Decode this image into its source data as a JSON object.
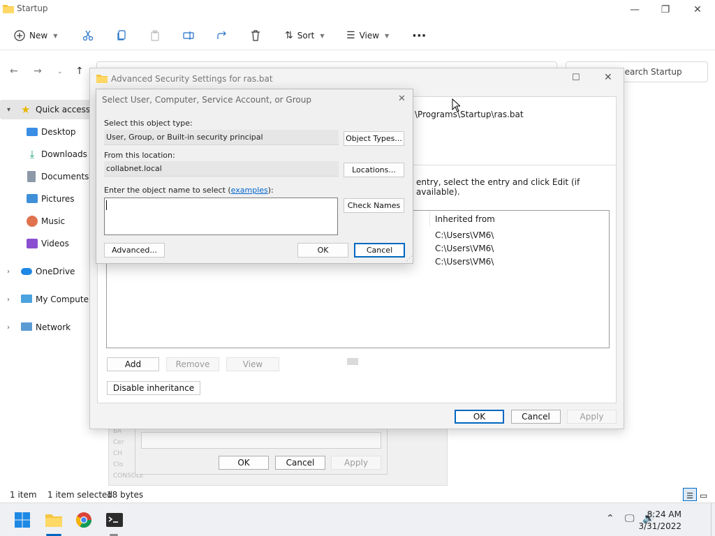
{
  "explorer": {
    "title": "Startup",
    "toolbar": {
      "new_label": "New",
      "sort_label": "Sort",
      "view_label": "View",
      "more_label": "···"
    },
    "search_placeholder": "Search Startup",
    "sidebar": {
      "quick_access": "Quick access",
      "desktop": "Desktop",
      "downloads": "Downloads",
      "documents": "Documents",
      "pictures": "Pictures",
      "music": "Music",
      "videos": "Videos",
      "onedrive": "OneDrive",
      "my_computer": "My Computer",
      "network": "Network"
    },
    "status": {
      "items": "1 item",
      "selected": "1 item selected",
      "size": "18 bytes"
    }
  },
  "advanced": {
    "title": "Advanced Security Settings for ras.bat",
    "path_text": "\\Programs\\Startup\\ras.bat",
    "instruction": "entry, select the entry and click Edit (if available).",
    "column_inherited": "Inherited from",
    "rows": [
      "C:\\Users\\VM6\\",
      "C:\\Users\\VM6\\",
      "C:\\Users\\VM6\\"
    ],
    "add_label": "Add",
    "remove_label": "Remove",
    "view_label": "View",
    "disable_inheritance_label": "Disable inheritance",
    "ok_label": "OK",
    "cancel_label": "Cancel",
    "apply_label": "Apply"
  },
  "background_dialog": {
    "ok_label": "OK",
    "cancel_label": "Cancel",
    "apply_label": "Apply",
    "ghost_rows": [
      "BA",
      "Cer",
      "CH",
      "Clo",
      "CONSOLE"
    ]
  },
  "select_dialog": {
    "title": "Select User, Computer, Service Account, or Group",
    "object_type_label": "Select this object type:",
    "object_type_value": "User, Group, or Built-in security principal",
    "object_types_button": "Object Types...",
    "location_label": "From this location:",
    "location_value": "collabnet.local",
    "locations_button": "Locations...",
    "enter_label_prefix": "Enter the object name to select (",
    "examples_link": "examples",
    "enter_label_suffix": "):",
    "check_names_button": "Check Names",
    "advanced_button": "Advanced...",
    "ok_button": "OK",
    "cancel_button": "Cancel"
  },
  "taskbar": {
    "time": "8:24 AM",
    "date": "3/31/2022"
  },
  "colors": {
    "accent": "#0067c0",
    "folder": "#f5c542",
    "link": "#0066cc"
  }
}
